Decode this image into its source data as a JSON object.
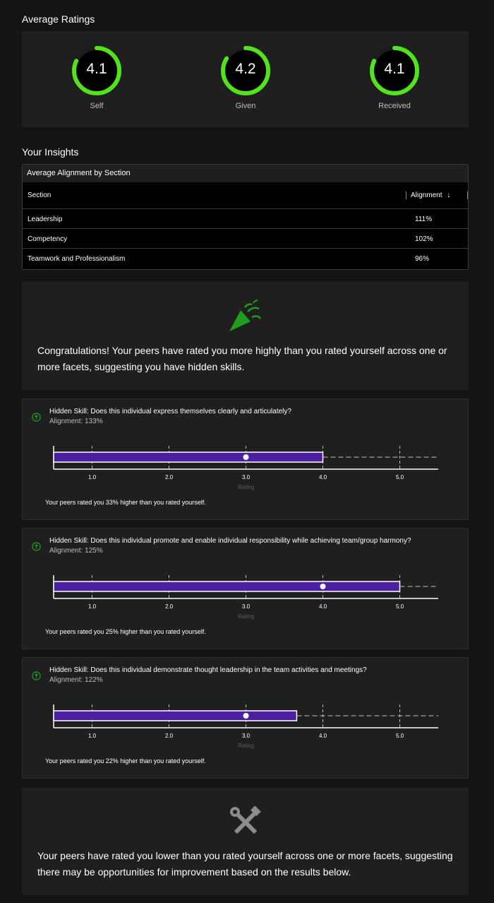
{
  "ratings": {
    "title": "Average Ratings",
    "items": [
      {
        "label": "Self",
        "value": "4.1",
        "fraction": 0.82
      },
      {
        "label": "Given",
        "value": "4.2",
        "fraction": 0.84
      },
      {
        "label": "Received",
        "value": "4.1",
        "fraction": 0.82
      }
    ],
    "ring_color": "#52e31c"
  },
  "insights": {
    "title": "Your Insights",
    "table_title": "Average Alignment by Section",
    "col_section": "Section",
    "col_alignment": "Alignment",
    "rows": [
      {
        "section": "Leadership",
        "alignment": "111%"
      },
      {
        "section": "Competency",
        "alignment": "102%"
      },
      {
        "section": "Teamwork and Professionalism",
        "alignment": "96%"
      }
    ]
  },
  "congrats": {
    "icon": "party-popper-icon",
    "text": "Congratulations! Your peers have rated you more highly than you rated yourself across one or more facets, suggesting you have hidden skills."
  },
  "skills": [
    {
      "title": "Hidden Skill: Does this individual express themselves clearly and articulately?",
      "alignment": "Alignment: 133%",
      "self": 3.0,
      "peers": 4.0,
      "footer": "Your peers rated you 33% higher than you rated yourself."
    },
    {
      "title": "Hidden Skill: Does this individual promote and enable individual responsibility while achieving team/group harmony?",
      "alignment": "Alignment: 125%",
      "self": 4.0,
      "peers": 5.0,
      "footer": "Your peers rated you 25% higher than you rated yourself."
    },
    {
      "title": "Hidden Skill: Does this individual demonstrate thought leadership in the team activities and meetings?",
      "alignment": "Alignment: 122%",
      "self": 3.0,
      "peers": 3.66,
      "footer": "Your peers rated you 22% higher than you rated yourself."
    }
  ],
  "chart_data": {
    "type": "bar",
    "xlabel": "Rating",
    "ticks": [
      "1.0",
      "2.0",
      "3.0",
      "4.0",
      "5.0"
    ],
    "xlim": [
      0.5,
      5.5
    ],
    "bar_color": "#4b1fa0",
    "grid": true
  },
  "improvement": {
    "icon": "tools-icon",
    "text": "Your peers have rated you lower than you rated yourself across one or more facets, suggesting there may be opportunities for improvement based on the results below."
  }
}
